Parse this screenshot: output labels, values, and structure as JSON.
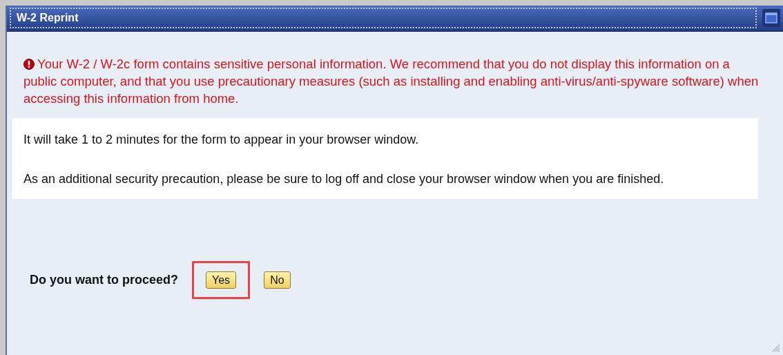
{
  "window": {
    "title": "W-2 Reprint"
  },
  "warning": "Your W-2 / W-2c form contains sensitive personal information. We recommend that you do not display this information on a public computer, and that you use precautionary measures (such as installing and enabling anti-virus/anti-spyware software) when accessing this information from home.",
  "info": [
    "It will take 1 to 2 minutes for the form to appear in your browser window.",
    "As an additional security precaution, please be sure to log off and close your browser window when you are finished."
  ],
  "question": "Do you want to proceed?",
  "buttons": [
    {
      "label": "Yes",
      "highlighted": true
    },
    {
      "label": "No",
      "highlighted": false
    }
  ]
}
